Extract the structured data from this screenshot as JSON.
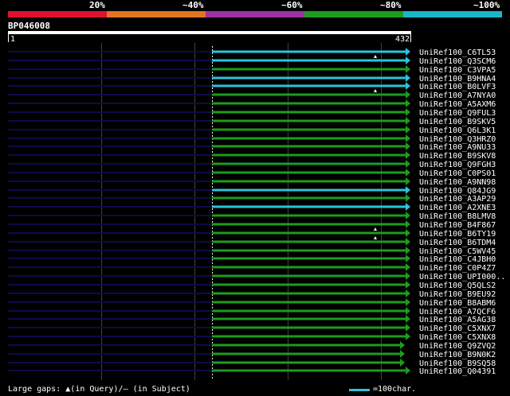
{
  "colors": {
    "legend": [
      "#e0112f",
      "#e0761e",
      "#9b33a4",
      "#1d9c1d",
      "#19b7c8"
    ],
    "hit_green": "#1d9c1d",
    "hit_cyan": "#2bc4dc",
    "left_track": "#0b0b48",
    "grid": "#404040",
    "white": "#ffffff"
  },
  "legend_labels": [
    "20%",
    "~40%",
    "~60%",
    "~80%",
    "~100%"
  ],
  "query": {
    "id": "BP046008",
    "start": "1",
    "end": "432"
  },
  "hits": [
    {
      "label": "UniRef100_C6TL53",
      "color": "cyan",
      "end": 432,
      "gap": true
    },
    {
      "label": "UniRef100_Q3SCM6",
      "color": "cyan",
      "end": 432,
      "gap": false
    },
    {
      "label": "UniRef100_C3VPA5",
      "color": "green",
      "end": 432,
      "gap": false
    },
    {
      "label": "UniRef100_B9HNA4",
      "color": "cyan",
      "end": 432,
      "gap": false
    },
    {
      "label": "UniRef100_B0LVF3",
      "color": "cyan",
      "end": 432,
      "gap": true
    },
    {
      "label": "UniRef100_A7NYA0",
      "color": "green",
      "end": 432,
      "gap": false
    },
    {
      "label": "UniRef100_A5AXM6",
      "color": "green",
      "end": 432,
      "gap": false
    },
    {
      "label": "UniRef100_Q9FUL3",
      "color": "green",
      "end": 432,
      "gap": false
    },
    {
      "label": "UniRef100_B9SKV5",
      "color": "green",
      "end": 432,
      "gap": false
    },
    {
      "label": "UniRef100_Q6L3K1",
      "color": "green",
      "end": 432,
      "gap": false
    },
    {
      "label": "UniRef100_Q3HRZ0",
      "color": "green",
      "end": 432,
      "gap": false
    },
    {
      "label": "UniRef100_A9NU33",
      "color": "green",
      "end": 432,
      "gap": false
    },
    {
      "label": "UniRef100_B9SKV8",
      "color": "green",
      "end": 432,
      "gap": false
    },
    {
      "label": "UniRef100_Q9FGH3",
      "color": "green",
      "end": 432,
      "gap": false
    },
    {
      "label": "UniRef100_C0PS01",
      "color": "green",
      "end": 432,
      "gap": false
    },
    {
      "label": "UniRef100_A9NN98",
      "color": "green",
      "end": 432,
      "gap": false
    },
    {
      "label": "UniRef100_Q84JG9",
      "color": "cyan",
      "end": 432,
      "gap": false
    },
    {
      "label": "UniRef100_A3AP29",
      "color": "green",
      "end": 432,
      "gap": false
    },
    {
      "label": "UniRef100_A2XNE3",
      "color": "cyan",
      "end": 432,
      "gap": false
    },
    {
      "label": "UniRef100_B8LMV8",
      "color": "green",
      "end": 432,
      "gap": false
    },
    {
      "label": "UniRef100_B4F867",
      "color": "green",
      "end": 432,
      "gap": true
    },
    {
      "label": "UniRef100_B6TY19",
      "color": "green",
      "end": 432,
      "gap": true
    },
    {
      "label": "UniRef100_B6TDM4",
      "color": "green",
      "end": 432,
      "gap": false
    },
    {
      "label": "UniRef100_C5WV45",
      "color": "green",
      "end": 432,
      "gap": false
    },
    {
      "label": "UniRef100_C4JBH0",
      "color": "green",
      "end": 432,
      "gap": false
    },
    {
      "label": "UniRef100_C0P4Z7",
      "color": "green",
      "end": 432,
      "gap": false
    },
    {
      "label": "UniRef100_UPI000..",
      "color": "green",
      "end": 432,
      "gap": false
    },
    {
      "label": "UniRef100_Q5QLS2",
      "color": "green",
      "end": 432,
      "gap": false
    },
    {
      "label": "UniRef100_B9EU92",
      "color": "green",
      "end": 432,
      "gap": false
    },
    {
      "label": "UniRef100_B8ABM6",
      "color": "green",
      "end": 432,
      "gap": false
    },
    {
      "label": "UniRef100_A7QCF6",
      "color": "green",
      "end": 432,
      "gap": false
    },
    {
      "label": "UniRef100_A5AG38",
      "color": "green",
      "end": 432,
      "gap": false
    },
    {
      "label": "UniRef100_C5XNX7",
      "color": "green",
      "end": 432,
      "gap": false
    },
    {
      "label": "UniRef100_C5XNX8",
      "color": "green",
      "end": 432,
      "gap": false
    },
    {
      "label": "UniRef100_Q9ZVQ2",
      "color": "green",
      "end": 426,
      "gap": false
    },
    {
      "label": "UniRef100_B9N0K2",
      "color": "green",
      "end": 426,
      "gap": false
    },
    {
      "label": "UniRef100_B9SQ58",
      "color": "green",
      "end": 426,
      "gap": false
    },
    {
      "label": "UniRef100_Q04391",
      "color": "green",
      "end": 432,
      "gap": false
    }
  ],
  "hit_start": 219,
  "footer": {
    "gaps_prefix": "Large gaps:",
    "gaps_query_glyph": "▲",
    "gaps_query_text": "(in Query)/",
    "gaps_subject_glyph": "–",
    "gaps_subject_text": " (in Subject)",
    "scale_text": "=100char."
  }
}
